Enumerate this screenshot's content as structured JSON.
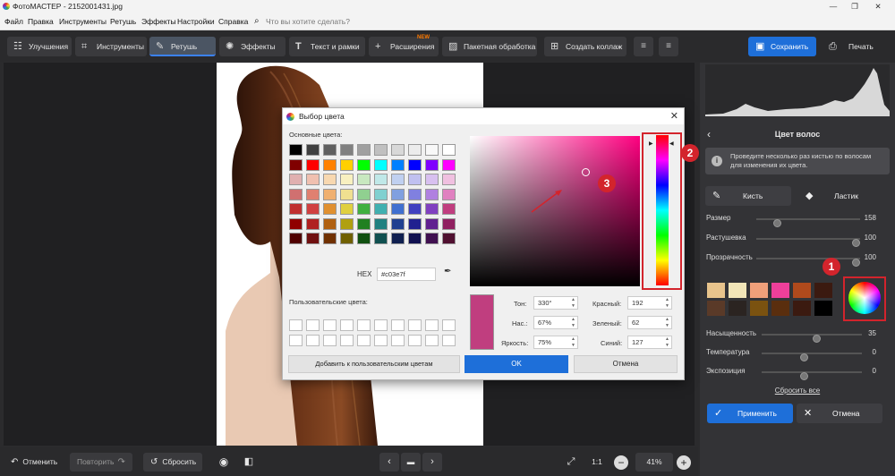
{
  "window": {
    "title": "ФотоМАСТЕР - 2152001431.jpg",
    "min": "—",
    "max": "❐",
    "close": "✕"
  },
  "menu": [
    "Файл",
    "Правка",
    "Инструменты",
    "Ретушь",
    "Эффекты",
    "Настройки",
    "Справка"
  ],
  "search": {
    "placeholder": "Что вы хотите сделать?"
  },
  "toolbar": {
    "enhance": "Улучшения",
    "tools": "Инструменты",
    "retouch": "Ретушь",
    "effects": "Эффекты",
    "text": "Текст и рамки",
    "extensions": "Расширения",
    "new_badge": "NEW",
    "batch": "Пакетная обработка",
    "collage": "Создать коллаж",
    "save": "Сохранить",
    "print": "Печать"
  },
  "bottom": {
    "undo": "Отменить",
    "redo": "Повторить",
    "reset": "Сбросить",
    "ratio": "1:1",
    "zoom": "41%"
  },
  "panel": {
    "title": "Цвет волос",
    "hint": "Проведите несколько раз кистью по волосам для изменения их цвета.",
    "brush": "Кисть",
    "eraser": "Ластик",
    "sliders": [
      {
        "label": "Размер",
        "value": "158",
        "level": 0.18
      },
      {
        "label": "Растушевка",
        "value": "100",
        "level": 1.0
      },
      {
        "label": "Прозрачность",
        "value": "100",
        "level": 1.0
      }
    ],
    "sliders2": [
      {
        "label": "Насыщенность",
        "value": "35",
        "level": 0.55
      },
      {
        "label": "Температура",
        "value": "0",
        "level": 0.42
      },
      {
        "label": "Экспозиция",
        "value": "0",
        "level": 0.42
      }
    ],
    "swatches": [
      "#e8c48c",
      "#f2e6b8",
      "#f0a07a",
      "#ee3f9a",
      "#b04a1c",
      "#3b1a10",
      "#5a3a28",
      "#2b2421",
      "#7a5210",
      "#5a2e0e",
      "#3b1a10",
      "#000000"
    ],
    "reset_all": "Сбросить все",
    "apply": "Применить",
    "cancel": "Отмена"
  },
  "dialog": {
    "title": "Выбор цвета",
    "basic_label": "Основные цвета:",
    "custom_label": "Пользовательские цвета:",
    "hex_label": "HEX",
    "hex_value": "#c03e7f",
    "hue_label": "Тон:",
    "hue": "330°",
    "sat_label": "Нас.:",
    "sat": "67%",
    "val_label": "Яркость:",
    "val": "75%",
    "red_label": "Красный:",
    "red": "192",
    "green_label": "Зеленый:",
    "green": "62",
    "blue_label": "Синий:",
    "blue": "127",
    "add_custom": "Добавить к пользовательским цветам",
    "ok": "OK",
    "cancel": "Отмена",
    "selected_color": "#c03e7f",
    "basic_colors": [
      [
        "#000000",
        "#404040",
        "#606060",
        "#808080",
        "#a0a0a0",
        "#c0c0c0",
        "#d8d8d8",
        "#ececec",
        "#f8f8f8",
        "#ffffff"
      ],
      [
        "#800000",
        "#ff0000",
        "#ff8000",
        "#ffd000",
        "#00ff00",
        "#00ffff",
        "#0080ff",
        "#0000ff",
        "#8000ff",
        "#ff00ff"
      ],
      [
        "#e0b0b0",
        "#f0c0b0",
        "#f8d8b0",
        "#f8f0c0",
        "#c8e8c0",
        "#c0e8e8",
        "#c0d0f0",
        "#c0c0f0",
        "#d8c0f0",
        "#f0c0e0"
      ],
      [
        "#d07070",
        "#e08070",
        "#f0b070",
        "#f0e090",
        "#90d090",
        "#80d0d0",
        "#80a0e0",
        "#8080e0",
        "#b080e0",
        "#e080c0"
      ],
      [
        "#c03030",
        "#d04040",
        "#e09030",
        "#e0d040",
        "#40b040",
        "#40b0b0",
        "#4070d0",
        "#4040c0",
        "#8040c0",
        "#c03e7f"
      ],
      [
        "#900000",
        "#b02020",
        "#b06010",
        "#b0a010",
        "#208020",
        "#208080",
        "#204090",
        "#202090",
        "#602090",
        "#902060"
      ],
      [
        "#500000",
        "#701010",
        "#703000",
        "#706000",
        "#105010",
        "#105050",
        "#102050",
        "#101050",
        "#401050",
        "#501030"
      ]
    ]
  },
  "annotations": {
    "one": "1",
    "two": "2",
    "three": "3"
  }
}
